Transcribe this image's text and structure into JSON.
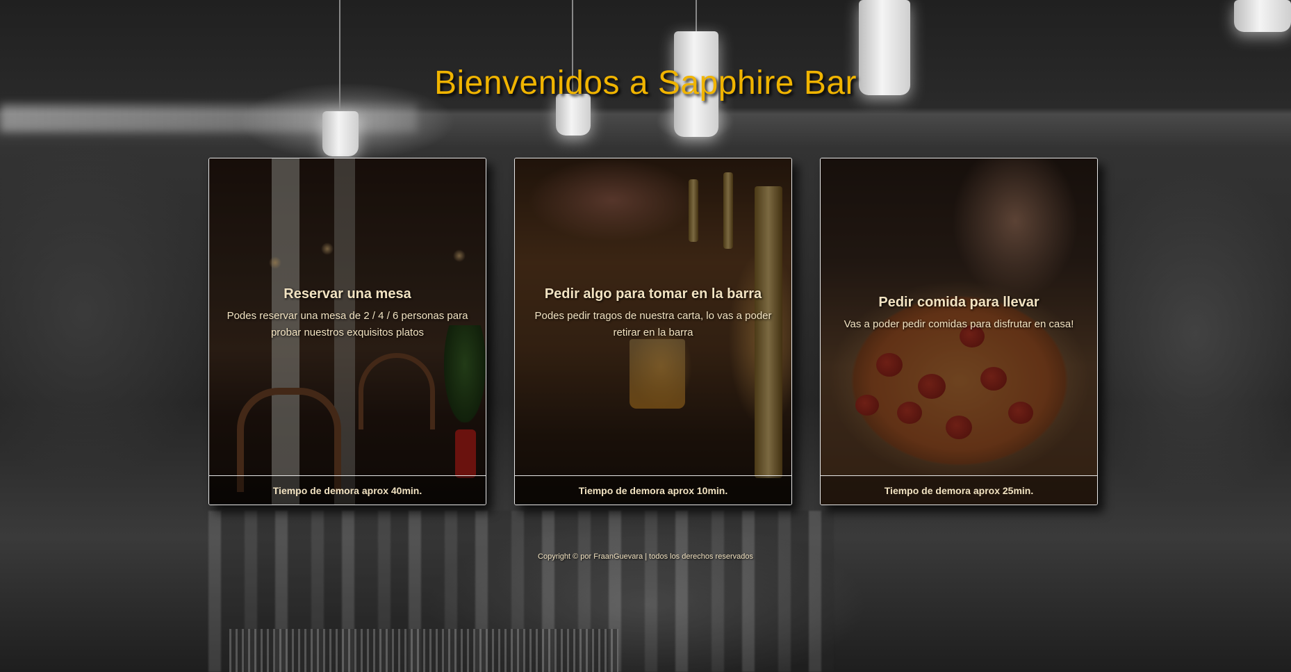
{
  "page": {
    "title": "Bienvenidos a Sapphire Bar",
    "title_color": "#f0b400",
    "text_color": "#f2e3c2"
  },
  "cards": [
    {
      "title": "Reservar una mesa",
      "text": "Podes reservar una mesa de 2 / 4 / 6 personas para probar nuestros exquisitos platos",
      "footer": "Tiempo de demora aprox 40min.",
      "image": "restaurant-interior"
    },
    {
      "title": "Pedir algo para tomar en la barra",
      "text": "Podes pedir tragos de nuestra carta, lo vas a poder retirar en la barra",
      "footer": "Tiempo de demora aprox 10min.",
      "image": "beer-tap"
    },
    {
      "title": "Pedir comida para llevar",
      "text": "Vas a poder pedir comidas para disfrutar en casa!",
      "footer": "Tiempo de demora aprox 25min.",
      "image": "pizza"
    }
  ],
  "footer": {
    "copyright": "Copyright © por FraanGuevara | todos los derechos reservados"
  }
}
